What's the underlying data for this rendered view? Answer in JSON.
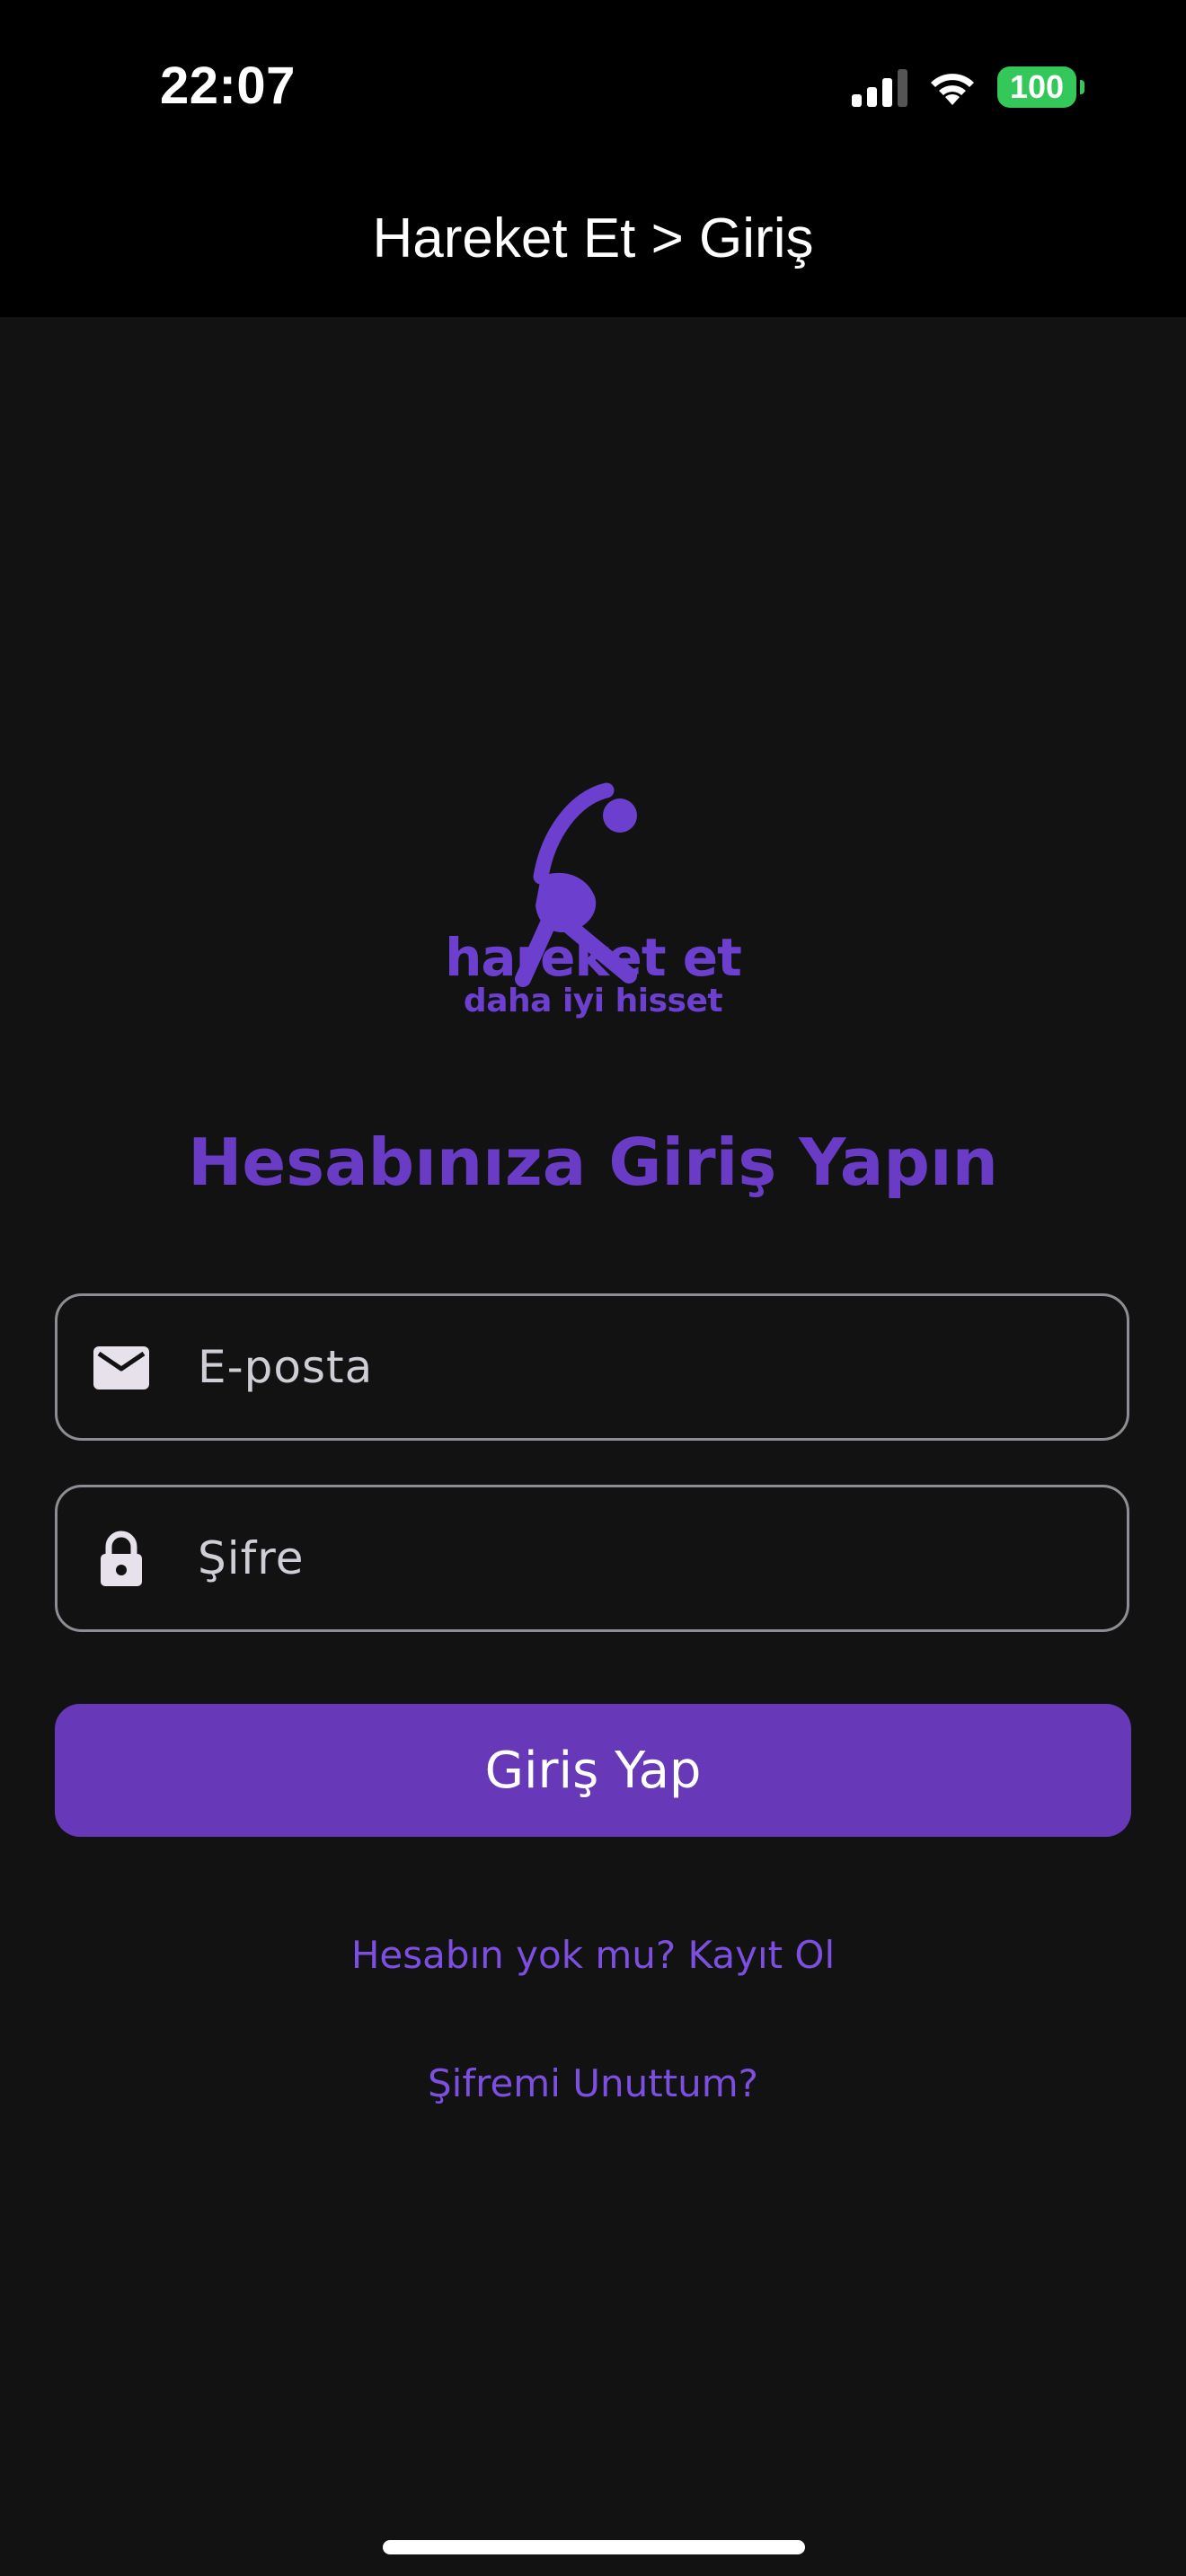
{
  "status_bar": {
    "time": "22:07",
    "battery": "100",
    "icons": [
      "cellular-signal-icon",
      "wifi-icon",
      "battery-icon"
    ]
  },
  "nav": {
    "title": "Hareket Et > Giriş"
  },
  "logo": {
    "wordmark": "hareket et",
    "tagline": "daha iyi hisset",
    "icon": "stretching-person-icon",
    "color": "#6c3fcf"
  },
  "form": {
    "heading": "Hesabınıza Giriş Yapın",
    "email": {
      "icon": "mail-icon",
      "placeholder": "E-posta",
      "value": ""
    },
    "password": {
      "icon": "lock-icon",
      "placeholder": "Şifre",
      "value": ""
    },
    "submit_label": "Giriş Yap",
    "register_link": "Hesabın yok mu? Kayıt Ol",
    "forgot_link": "Şifremi Unuttum?"
  },
  "colors": {
    "background": "#121212",
    "header": "#000000",
    "accent": "#6739b9",
    "link": "#7d4fe0",
    "battery": "#34c759"
  }
}
